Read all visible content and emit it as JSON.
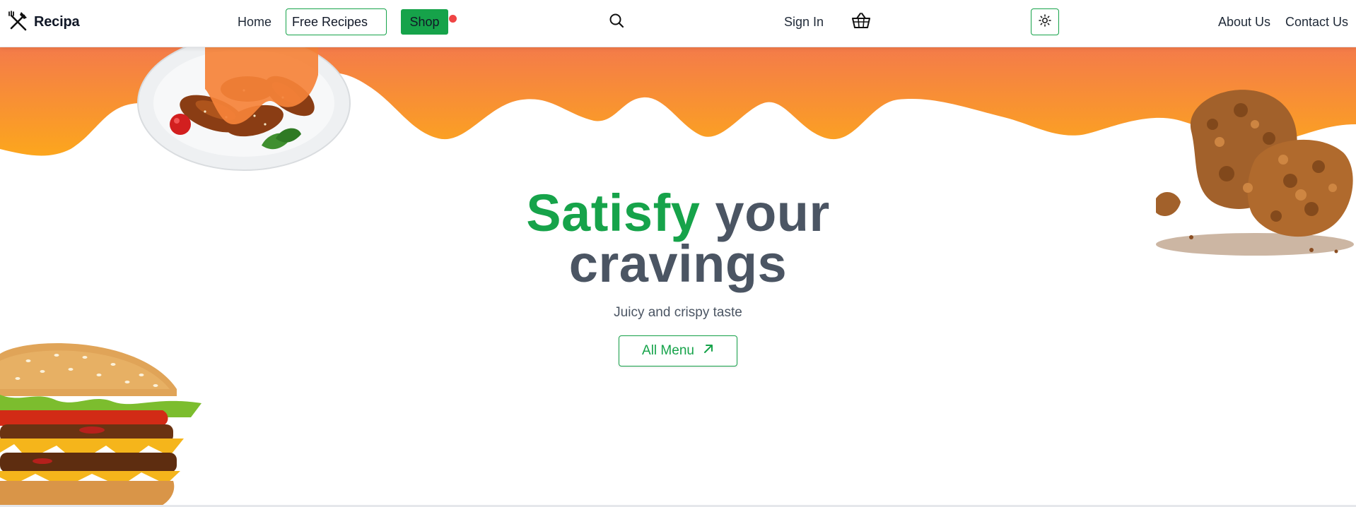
{
  "brand": {
    "name": "Recipa",
    "icon": "fork-knife-icon"
  },
  "nav": {
    "home": "Home",
    "free_recipes": "Free Recipes",
    "shop": "Shop",
    "sign_in": "Sign In",
    "about": "About Us",
    "contact": "Contact Us",
    "search_icon": "search-icon",
    "cart_icon": "basket-icon",
    "theme_icon": "sun-icon"
  },
  "hero": {
    "title_accent": "Satisfy",
    "title_rest": " your",
    "title_line2": "cravings",
    "subtitle": "Juicy and crispy taste",
    "cta_label": "All Menu",
    "cta_icon": "arrow-up-right-icon"
  },
  "colors": {
    "accent": "#16a34a",
    "drip_top": "#f47b4a",
    "drip_bottom": "#fca61d",
    "notification": "#ef4444",
    "text_dark": "#4b5563"
  }
}
